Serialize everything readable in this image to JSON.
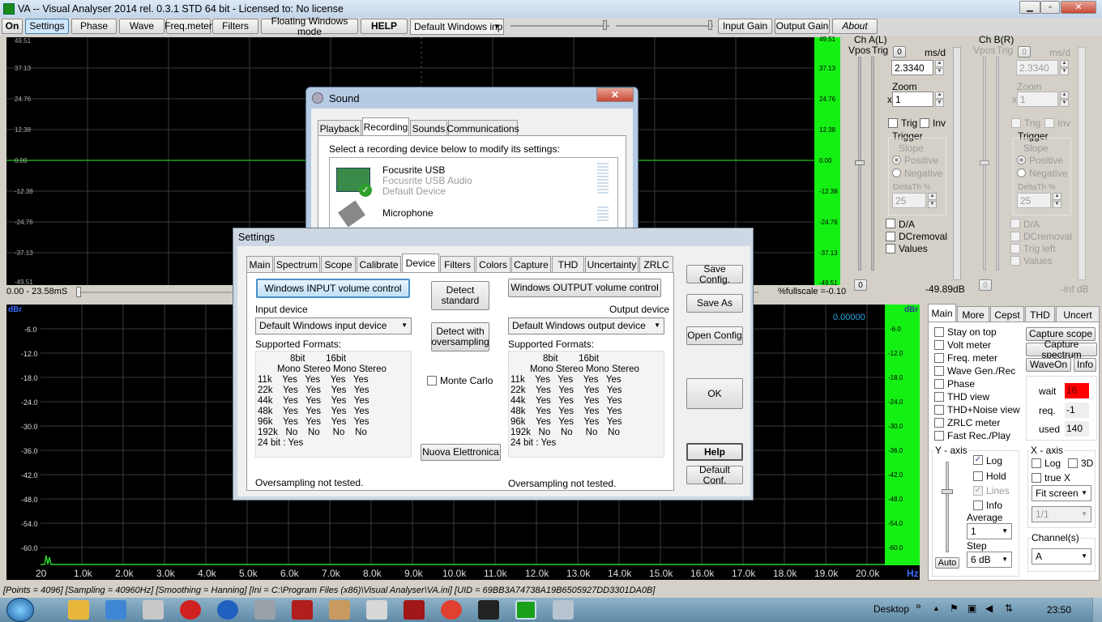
{
  "window": {
    "title": "VA -- Visual Analyser 2014 rel. 0.3.1 STD 64 bit - Licensed to: No license"
  },
  "toolbar": {
    "on": "On",
    "settings": "Settings",
    "phase": "Phase",
    "wave": "Wave",
    "freqmeter": "Freq.meter",
    "filters": "Filters",
    "floating": "Floating Windows mode",
    "help": "HELP",
    "device_select": "Default Windows inp",
    "input_gain": "Input Gain",
    "output_gain": "Output Gain",
    "about": "About"
  },
  "scope": {
    "yticks": [
      "49.51",
      "37.13",
      "24.76",
      "12.38",
      "0.00",
      "-12.38",
      "-24.76",
      "-37.13",
      "-49.51"
    ],
    "time_range": "0.00 - 23.58mS",
    "fullscale": "%fullscale =-0.10"
  },
  "spectrum": {
    "unit": "dBr",
    "value": "0.00000",
    "yticks": [
      "-6.0",
      "-12.0",
      "-18.0",
      "-24.0",
      "-30.0",
      "-36.0",
      "-42.0",
      "-48.0",
      "-54.0",
      "-60.0"
    ],
    "xticks": [
      "20",
      "1.0k",
      "2.0k",
      "3.0k",
      "4.0k",
      "5.0k",
      "6.0k",
      "7.0k",
      "8.0k",
      "9.0k",
      "10.0k",
      "11.0k",
      "12.0k",
      "13.0k",
      "14.0k",
      "15.0k",
      "16.0k",
      "17.0k",
      "18.0k",
      "19.0k",
      "20.0k"
    ],
    "xunit": "Hz"
  },
  "chA": {
    "title": "Ch A(L)",
    "vpos": "Vpos",
    "trig": "Trig",
    "zero": "0",
    "msd": "ms/d",
    "ms_value": "2.3340",
    "zoom": "Zoom",
    "zoom_x": "x",
    "zoom_value": "1",
    "trig_cb": "Trig",
    "inv_cb": "Inv",
    "trigger": "Trigger",
    "slope": "Slope",
    "positive": "Positive",
    "negative": "Negative",
    "delta": "DeltaTh %",
    "delta_value": "25",
    "da": "D/A",
    "dcremoval": "DCremoval",
    "values": "Values",
    "bottom_zero": "0",
    "db": "-49.89dB"
  },
  "chB": {
    "title": "Ch B(R)",
    "vpos": "Vpos",
    "trig": "Trig",
    "zero": "0",
    "msd": "ms/d",
    "ms_value": "2.3340",
    "zoom": "Zoom",
    "zoom_x": "x",
    "zoom_value": "1",
    "trig_cb": "Trig",
    "inv_cb": "Inv",
    "trigger": "Trigger",
    "slope": "Slope",
    "positive": "Positive",
    "negative": "Negative",
    "delta": "DeltaTh %",
    "delta_value": "25",
    "da": "D/A",
    "dcremoval": "DCremoval",
    "trigleft": "Trig left",
    "values": "Values",
    "bottom_zero": "0",
    "db": "-inf dB"
  },
  "rightpanel": {
    "tabs": [
      "Main",
      "More",
      "Cepst",
      "THD",
      "Uncert"
    ],
    "checks": [
      "Stay on top",
      "Volt meter",
      "Freq. meter",
      "Wave Gen./Rec",
      "Phase",
      "THD view",
      "THD+Noise view",
      "ZRLC meter",
      "Fast Rec./Play"
    ],
    "capture_scope": "Capture scope",
    "capture_spectrum": "Capture spectrum",
    "waveon": "WaveOn",
    "info": "Info",
    "wait": "wait",
    "wait_value": "16",
    "req": "req.",
    "req_value": "-1",
    "used": "used",
    "used_value": "140",
    "yaxis": "Y - axis",
    "log": "Log",
    "hold": "Hold",
    "lines": "Lines",
    "yinfo": "Info",
    "average": "Average",
    "average_value": "1",
    "step": "Step",
    "step_value": "6 dB",
    "auto": "Auto",
    "xaxis": "X - axis",
    "xlog": "Log",
    "x3d": "3D",
    "truex": "true X",
    "fit": "Fit screen",
    "ratio": "1/1",
    "channels": "Channel(s)",
    "channel_value": "A"
  },
  "sound": {
    "title": "Sound",
    "tabs": [
      "Playback",
      "Recording",
      "Sounds",
      "Communications"
    ],
    "instruction": "Select a recording device below to modify its settings:",
    "dev1_name": "Focusrite USB",
    "dev1_desc": "Focusrite USB Audio",
    "dev1_status": "Default Device",
    "dev2_name": "Microphone",
    "close": "✕"
  },
  "settings": {
    "title": "Settings",
    "tabs": [
      "Main",
      "Spectrum",
      "Scope",
      "Calibrate",
      "Device",
      "Filters",
      "Colors",
      "Capture",
      "THD",
      "Uncertainty",
      "ZRLC"
    ],
    "win_input": "Windows INPUT volume control",
    "win_output": "Windows OUTPUT volume control",
    "detect_std": "Detect standard",
    "detect_os": "Detect with oversampling",
    "monte": "Monte Carlo",
    "nuova": "Nuova Elettronica",
    "input_device": "Input device",
    "output_device": "Output device",
    "input_select": "Default Windows input device",
    "output_select": "Default Windows output device",
    "supported": "Supported Formats:",
    "fmt_header1": "8bit        16bit",
    "fmt_header2": "Mono Stereo Mono Stereo",
    "fmt_rows": [
      "11k    Yes   Yes    Yes   Yes",
      "22k    Yes   Yes    Yes   Yes",
      "44k    Yes   Yes    Yes   Yes",
      "48k    Yes   Yes    Yes   Yes",
      "96k    Yes   Yes    Yes   Yes",
      "192k   No    No     No    No",
      "24 bit : Yes"
    ],
    "os_in": "Oversampling not tested.",
    "os_out": "Oversampling not tested.",
    "save": "Save Config.",
    "saveas": "Save As",
    "open": "Open Config",
    "ok": "OK",
    "help": "Help",
    "default": "Default Conf."
  },
  "status": {
    "text": "[Points = 4096]  [Sampling = 40960Hz]  [Smoothing = Hanning]  [Ini = C:\\Program Files (x86)\\Visual Analyser\\VA.ini]  [UID = 69BB3A74738A19B6505927DD3301DA0B]"
  },
  "taskbar": {
    "desktop": "Desktop",
    "chevron": "»",
    "time": "23:50"
  },
  "colors": {
    "plot": "#000000",
    "green": "#14f014",
    "accent": "#2a63c4",
    "wait": "#ff0000"
  }
}
